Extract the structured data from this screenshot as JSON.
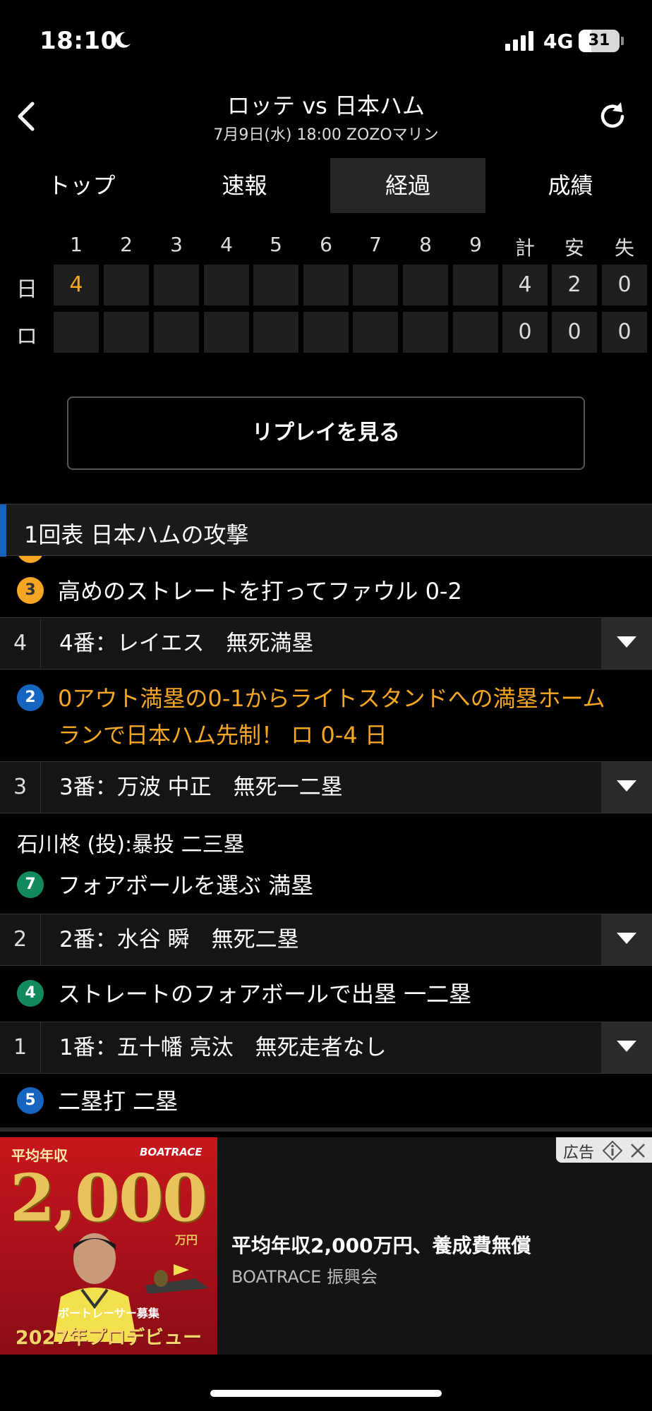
{
  "status_bar": {
    "time": "18:10",
    "network": "4G",
    "battery": "31",
    "battery_level": 0.31
  },
  "header": {
    "title": "ロッテ vs 日本ハム",
    "subtitle": "7月9日(水) 18:00 ZOZOマリン"
  },
  "tabs": [
    {
      "label": "トップ",
      "active": false
    },
    {
      "label": "速報",
      "active": false
    },
    {
      "label": "経過",
      "active": true
    },
    {
      "label": "成績",
      "active": false
    }
  ],
  "scoreboard": {
    "headers": [
      "1",
      "2",
      "3",
      "4",
      "5",
      "6",
      "7",
      "8",
      "9",
      "計",
      "安",
      "失"
    ],
    "rows": [
      {
        "team": "日",
        "innings": [
          "4",
          "",
          "",
          "",
          "",
          "",
          "",
          "",
          ""
        ],
        "totals": [
          "4",
          "2",
          "0"
        ]
      },
      {
        "team": "ロ",
        "innings": [
          "",
          "",
          "",
          "",
          "",
          "",
          "",
          "",
          ""
        ],
        "totals": [
          "0",
          "0",
          "0"
        ]
      }
    ],
    "highlight_color": "#f5a623"
  },
  "replay_button": "リプレイを見る",
  "play_by_play": {
    "inning_title": "1回表 日本ハムの攻撃",
    "items": [
      {
        "kind": "pitch",
        "badge": "3",
        "color": "yellow",
        "text": "高めのストレートを打ってファウル 0-2"
      },
      {
        "kind": "batter",
        "order": "4",
        "text": "4番：レイエス　無死満塁"
      },
      {
        "kind": "pitch",
        "badge": "2",
        "color": "blue",
        "line1": "0アウト満塁の0-1からライトスタンドへの満塁ホーム",
        "line2": "ランで日本ハム先制！ ロ 0-4 日",
        "highlight": true
      },
      {
        "kind": "batter",
        "order": "3",
        "text": "3番：万波 中正　無死一二塁"
      },
      {
        "kind": "note",
        "text": "石川柊 (投):暴投 二三塁"
      },
      {
        "kind": "pitch",
        "badge": "7",
        "color": "green",
        "text": "フォアボールを選ぶ 満塁"
      },
      {
        "kind": "batter",
        "order": "2",
        "text": "2番：水谷 瞬　無死二塁"
      },
      {
        "kind": "pitch",
        "badge": "4",
        "color": "green",
        "text": "ストレートのフォアボールで出塁 一二塁"
      },
      {
        "kind": "batter",
        "order": "1",
        "text": "1番：五十幡 亮汰　無死走者なし"
      },
      {
        "kind": "pitch",
        "badge": "5",
        "color": "blue",
        "text": "二塁打 二塁"
      }
    ]
  },
  "ad": {
    "label": "広告",
    "image_text": {
      "top_left": "平均年収",
      "brand": "BOATRACE",
      "big": "2,000",
      "unit": "万円",
      "recruit": "ボートレーサー募集",
      "debut": "2027年プロデビュー"
    },
    "headline": "平均年収2,000万円、養成費無償",
    "sponsor": "BOATRACE 振興会"
  }
}
